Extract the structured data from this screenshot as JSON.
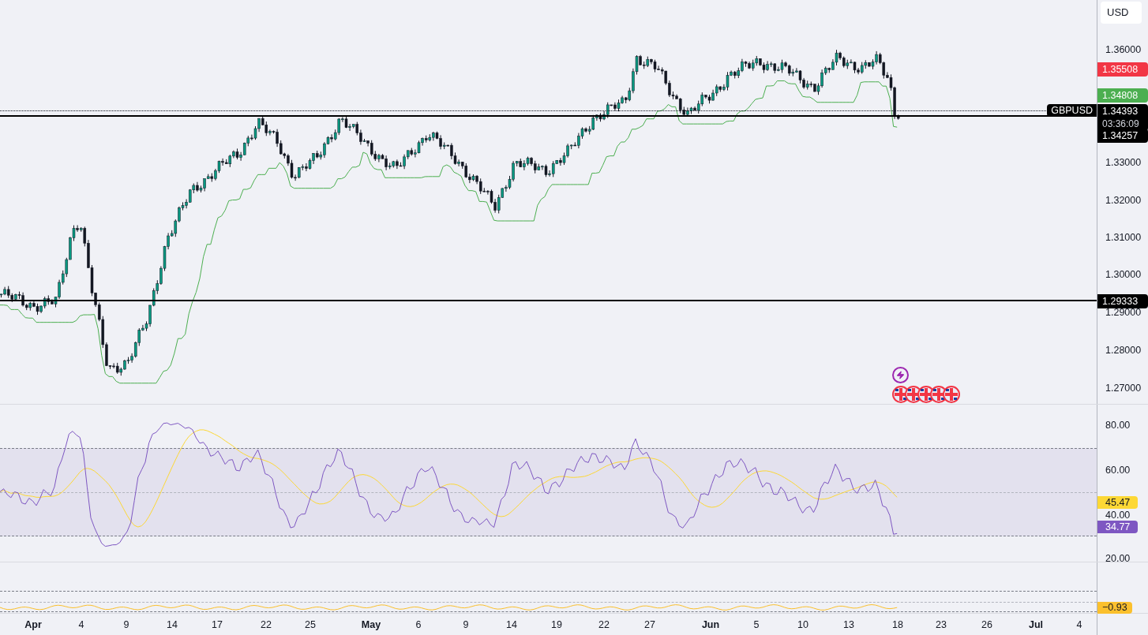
{
  "price_pane": {
    "currency": "USD",
    "symbol": "GBPUSD",
    "ticks": [
      "1.36000",
      "1.33000",
      "1.32000",
      "1.31000",
      "1.30000",
      "1.29000",
      "1.28000",
      "1.27000"
    ],
    "labels": [
      {
        "text": "1.35508",
        "color": "#f23645"
      },
      {
        "text": "1.34808",
        "color": "#4caf50"
      },
      {
        "text": "1.34393",
        "countdown": "03:36:09",
        "color": "#000000"
      },
      {
        "text": "1.34257",
        "color": "#000000"
      },
      {
        "text": "1.29333",
        "color": "#000000"
      }
    ]
  },
  "rsi_pane": {
    "ticks": [
      "80.00",
      "60.00",
      "40.00",
      "20.00"
    ],
    "labels": [
      {
        "text": "45.47",
        "color": "#fdd835"
      },
      {
        "text": "34.77",
        "color": "#7e57c2"
      }
    ]
  },
  "oscillator_pane": {
    "labels": [
      {
        "text": "−0.93",
        "color": "#fbc02d"
      }
    ]
  },
  "time_axis": [
    {
      "text": "Apr",
      "kind": "month"
    },
    {
      "text": "4",
      "kind": "day"
    },
    {
      "text": "9",
      "kind": "day"
    },
    {
      "text": "14",
      "kind": "day"
    },
    {
      "text": "17",
      "kind": "day"
    },
    {
      "text": "22",
      "kind": "day"
    },
    {
      "text": "25",
      "kind": "day"
    },
    {
      "text": "May",
      "kind": "month"
    },
    {
      "text": "6",
      "kind": "day"
    },
    {
      "text": "9",
      "kind": "day"
    },
    {
      "text": "14",
      "kind": "day"
    },
    {
      "text": "19",
      "kind": "day"
    },
    {
      "text": "22",
      "kind": "day"
    },
    {
      "text": "27",
      "kind": "day"
    },
    {
      "text": "Jun",
      "kind": "month"
    },
    {
      "text": "5",
      "kind": "day"
    },
    {
      "text": "10",
      "kind": "day"
    },
    {
      "text": "13",
      "kind": "day"
    },
    {
      "text": "18",
      "kind": "day"
    },
    {
      "text": "23",
      "kind": "day"
    },
    {
      "text": "26",
      "kind": "day"
    },
    {
      "text": "Jul",
      "kind": "month"
    },
    {
      "text": "4",
      "kind": "day"
    }
  ]
}
